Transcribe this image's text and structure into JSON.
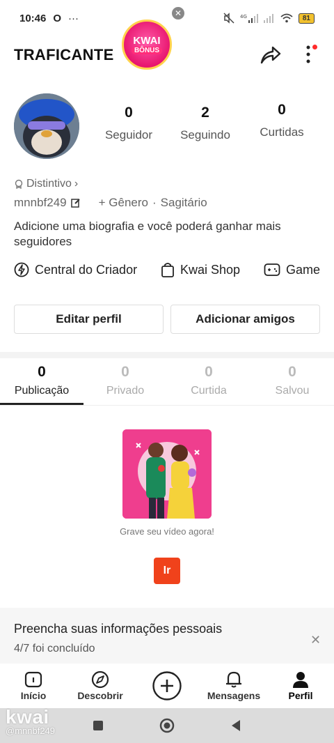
{
  "status_bar": {
    "time": "10:46",
    "battery": "81"
  },
  "header": {
    "username_title": "TRAFICANTE",
    "bonus_line1": "KWAI",
    "bonus_line2": "BÔNUS"
  },
  "profile": {
    "stats": [
      {
        "value": "0",
        "label": "Seguidor"
      },
      {
        "value": "2",
        "label": "Seguindo"
      },
      {
        "value": "0",
        "label": "Curtidas"
      }
    ],
    "badge_label": "Distintivo",
    "handle": "mnnbf249",
    "gender_label": "+ Gênero",
    "separator": "·",
    "zodiac": "Sagitário",
    "bio": "Adicione uma biografia e você poderá ganhar mais seguidores"
  },
  "links": {
    "creator_center": "Central do Criador",
    "shop": "Kwai Shop",
    "game": "Game"
  },
  "buttons": {
    "edit_profile": "Editar perfil",
    "add_friends": "Adicionar amigos"
  },
  "tabs": [
    {
      "count": "0",
      "label": "Publicação"
    },
    {
      "count": "0",
      "label": "Privado"
    },
    {
      "count": "0",
      "label": "Curtida"
    },
    {
      "count": "0",
      "label": "Salvou"
    }
  ],
  "empty_state": {
    "message": "Grave seu vídeo agora!",
    "button_label": "Ir"
  },
  "banner": {
    "title": "Preencha suas informações pessoais",
    "progress": "4/7 foi concluído"
  },
  "bottom_nav": {
    "home": "Início",
    "discover": "Descobrir",
    "messages": "Mensagens",
    "profile": "Perfil"
  },
  "watermark": {
    "brand": "kwai",
    "handle": "@mnnbf249"
  },
  "colors": {
    "accent": "#f0421b",
    "bonus": "#e8166f"
  }
}
